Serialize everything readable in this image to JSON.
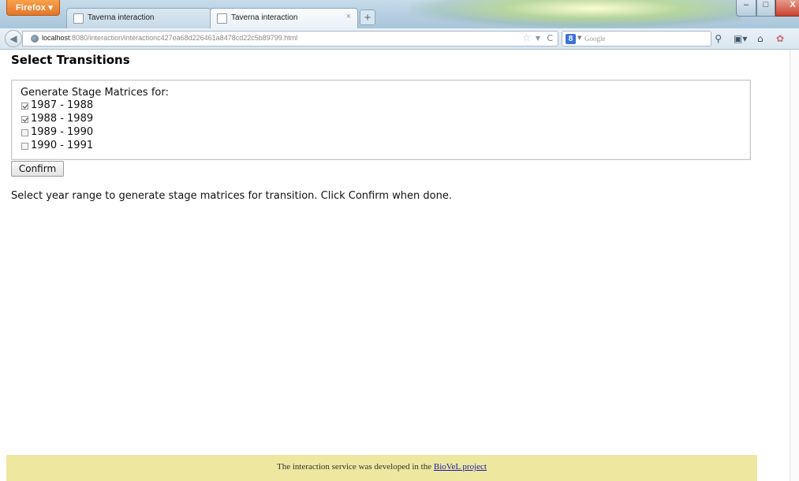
{
  "browser": {
    "menu_button_label": "Firefox ▾",
    "tabs": [
      {
        "title": "Taverna interaction",
        "active": false
      },
      {
        "title": "Taverna interaction",
        "active": true
      }
    ],
    "new_tab_label": "+",
    "tab_close_glyph": "×",
    "url": {
      "host": "localhost",
      "rest": ":8080/interaction/interactionc427ea68d226461a8478cd22c5b89799.html"
    },
    "search_engine": "Google",
    "search_engine_badge": "8",
    "window_controls": {
      "minimize": "–",
      "maximize": "□",
      "close": "X"
    },
    "icons": [
      "back-arrow-icon",
      "site-identity-icon",
      "bookmark-star-icon",
      "reload-icon",
      "google-icon",
      "search-icon",
      "page-menu-icon",
      "home-icon",
      "addon-icon"
    ]
  },
  "page": {
    "title": "Select Transitions",
    "form": {
      "legend": "Generate Stage Matrices for:",
      "options": [
        {
          "label": "1987 - 1988",
          "checked": true
        },
        {
          "label": "1988 - 1989",
          "checked": true
        },
        {
          "label": "1989 - 1990",
          "checked": false
        },
        {
          "label": "1990 - 1991",
          "checked": false
        }
      ],
      "confirm_label": "Confirm"
    },
    "instructions": "Select year range to generate stage matrices for transition. Click Confirm when done.",
    "footer": {
      "text": "The interaction service was developed in the ",
      "link_text": "BioVeL project"
    }
  },
  "colors": {
    "footer_background": "#eee7a0",
    "firefox_button": "#e5762a",
    "link": "#1a1aa6"
  }
}
